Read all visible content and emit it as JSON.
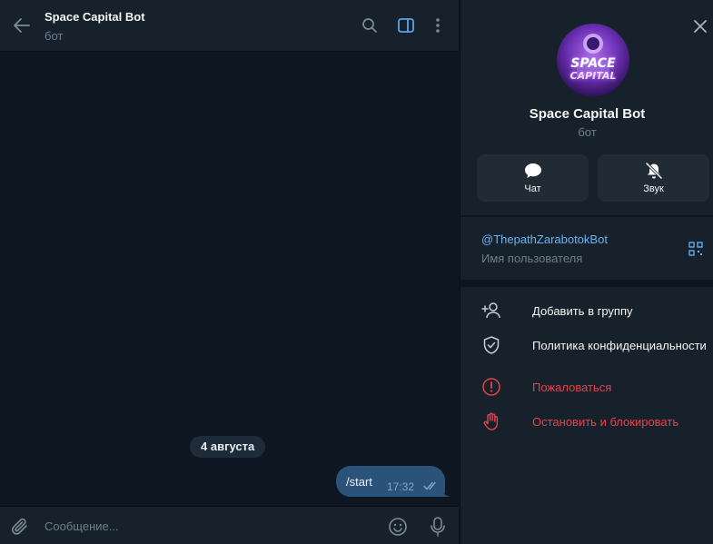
{
  "chat": {
    "header": {
      "title": "Space Capital Bot",
      "subtitle": "бот"
    },
    "date_separator": "4 августа",
    "messages": [
      {
        "text": "/start",
        "time": "17:32",
        "status": "read",
        "outgoing": true
      }
    ],
    "composer": {
      "placeholder": "Сообщение..."
    }
  },
  "profile": {
    "avatar_logo_line1": "SPACE",
    "avatar_logo_line2": "CAPITAL",
    "name": "Space Capital Bot",
    "subtitle": "бот",
    "actions": [
      {
        "label": "Чат",
        "icon": "chat-bubble-icon"
      },
      {
        "label": "Звук",
        "icon": "bell-muted-icon"
      }
    ],
    "username": "@ThepathZarabotokBot",
    "username_caption": "Имя пользователя",
    "menu": [
      {
        "label": "Добавить в группу",
        "icon": "add-user-icon"
      },
      {
        "label": "Политика конфиденциальности",
        "icon": "shield-check-icon"
      },
      {
        "label": "Пожаловаться",
        "icon": "alert-circle-icon",
        "danger": true
      },
      {
        "label": "Остановить и блокировать",
        "icon": "hand-stop-icon",
        "danger": true
      }
    ]
  },
  "colors": {
    "accent": "#6ab3f3",
    "danger": "#e5424d",
    "bubble_out": "#2b5278",
    "panel_bg": "#17212b",
    "chat_bg": "#0e1621"
  }
}
